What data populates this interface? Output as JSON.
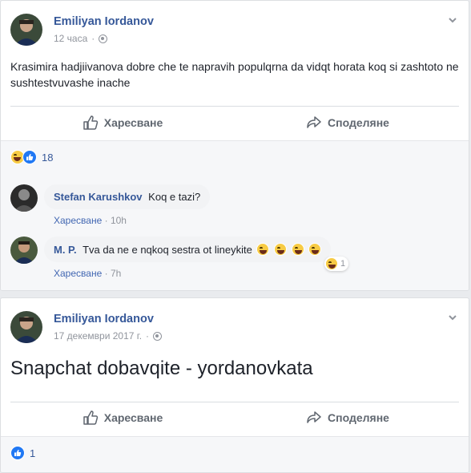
{
  "post1": {
    "author": "Emiliyan Iordanov",
    "time": "12 часа",
    "text": "Krasimira hadjiivanova dobre che te napravih populqrna da vidqt horata koq si zashtoto ne sushtestvuvashe inache",
    "like_label": "Харесване",
    "share_label": "Споделяне",
    "reaction_count": "18",
    "comments": [
      {
        "author": "Stefan Karushkov",
        "text": "Koq e tazi?",
        "like_label": "Харесване",
        "sep": "·",
        "time": "10h"
      },
      {
        "author": "M. P.",
        "text": "Tva da ne e nqkoq sestra ot lineykite",
        "like_label": "Харесване",
        "sep": "·",
        "time": "7h",
        "reaction_count": "1"
      }
    ]
  },
  "post2": {
    "author": "Emiliyan Iordanov",
    "time": "17 декември 2017 г.",
    "text": "Snapchat dobavqite - yordanovkata",
    "like_label": "Харесване",
    "share_label": "Споделяне",
    "reaction_count": "1"
  },
  "meta_sep": "·",
  "colors": {
    "link": "#365899",
    "like_blue": "#2078f4",
    "muted": "#90949c"
  },
  "icons": [
    "thumbs-up-icon",
    "share-arrow-icon",
    "globe-icon",
    "chevron-down-icon",
    "haha-emoji-icon",
    "like-reaction-icon"
  ]
}
